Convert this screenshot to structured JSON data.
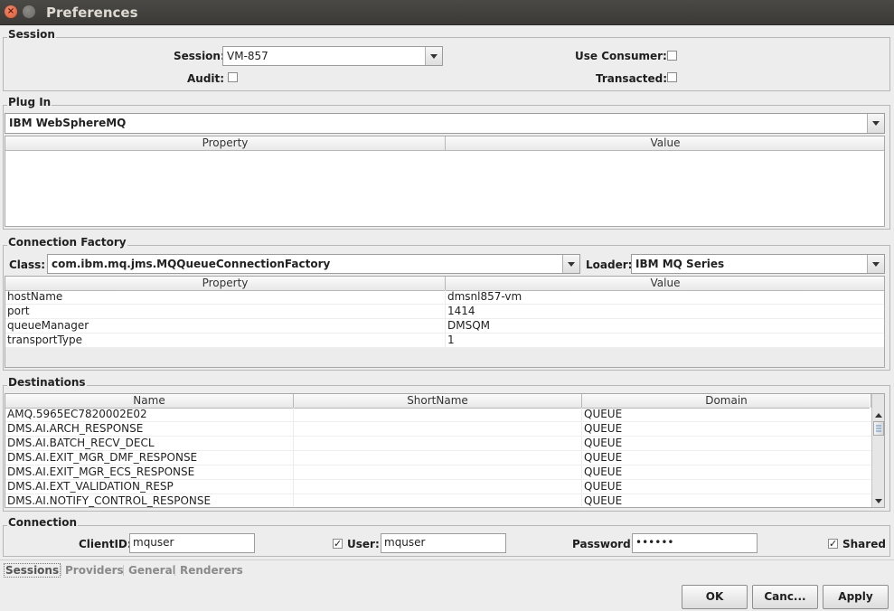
{
  "window": {
    "title": "Preferences"
  },
  "session": {
    "title": "Session",
    "session_label": "Session:",
    "session_value": "VM-857",
    "audit_label": "Audit:",
    "audit_checked": false,
    "use_consumer_label": "Use Consumer:",
    "use_consumer_checked": false,
    "transacted_label": "Transacted:",
    "transacted_checked": false
  },
  "plugin": {
    "title": "Plug In",
    "selected": "IBM WebSphereMQ",
    "columns": [
      "Property",
      "Value"
    ]
  },
  "connection_factory": {
    "title": "Connection Factory",
    "class_label": "Class:",
    "class_value": "com.ibm.mq.jms.MQQueueConnectionFactory",
    "loader_label": "Loader:",
    "loader_value": "IBM MQ Series",
    "columns": [
      "Property",
      "Value"
    ],
    "rows": [
      [
        "hostName",
        "dmsnl857-vm"
      ],
      [
        "port",
        "1414"
      ],
      [
        "queueManager",
        "DMSQM"
      ],
      [
        "transportType",
        "1"
      ]
    ]
  },
  "destinations": {
    "title": "Destinations",
    "columns": [
      "Name",
      "ShortName",
      "Domain"
    ],
    "rows": [
      [
        "AMQ.5965EC7820002E02",
        "",
        "QUEUE"
      ],
      [
        "DMS.AI.ARCH_RESPONSE",
        "",
        "QUEUE"
      ],
      [
        "DMS.AI.BATCH_RECV_DECL",
        "",
        "QUEUE"
      ],
      [
        "DMS.AI.EXIT_MGR_DMF_RESPONSE",
        "",
        "QUEUE"
      ],
      [
        "DMS.AI.EXIT_MGR_ECS_RESPONSE",
        "",
        "QUEUE"
      ],
      [
        "DMS.AI.EXT_VALIDATION_RESP",
        "",
        "QUEUE"
      ],
      [
        "DMS.AI.NOTIFY_CONTROL_RESPONSE",
        "",
        "QUEUE"
      ]
    ]
  },
  "connection": {
    "title": "Connection",
    "client_id_label": "ClientID:",
    "client_id_value": "mquser",
    "user_label": "User:",
    "user_checked": true,
    "user_value": "mquser",
    "password_label": "Password:",
    "password_value": "••••••",
    "shared_label": "Shared",
    "shared_checked": true
  },
  "tabs": [
    "Sessions",
    "Providers",
    "General",
    "Renderers"
  ],
  "buttons": {
    "ok": "OK",
    "cancel": "Canc...",
    "apply": "Apply"
  }
}
